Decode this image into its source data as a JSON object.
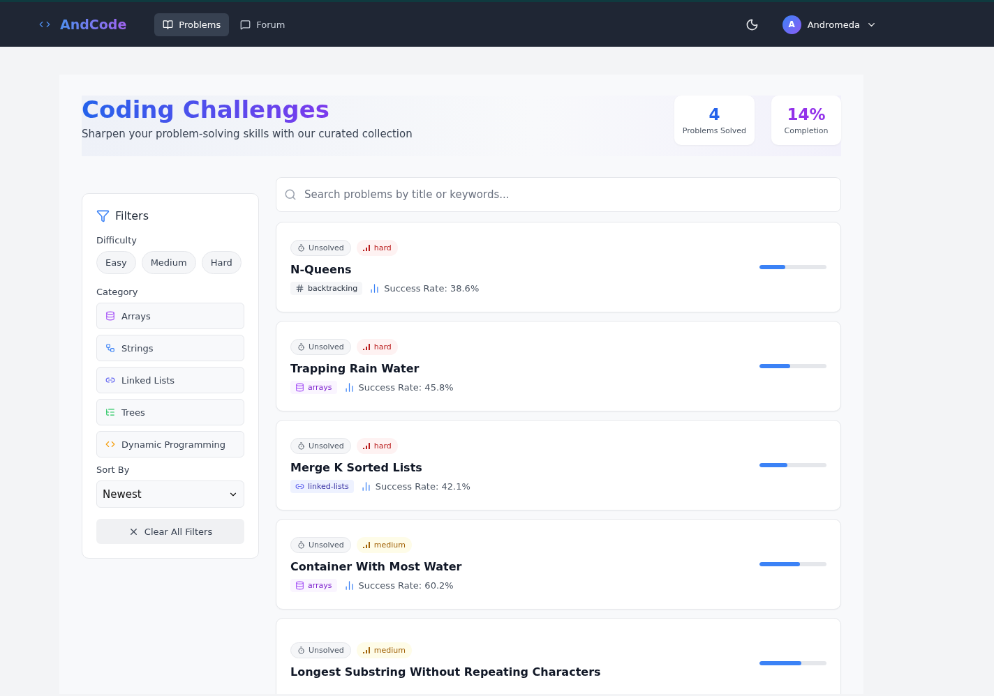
{
  "nav": {
    "logo": "AndCode",
    "links": [
      {
        "label": "Problems",
        "selected": true
      },
      {
        "label": "Forum",
        "selected": false
      }
    ],
    "user": {
      "initial": "A",
      "name": "Andromeda"
    }
  },
  "header": {
    "title": "Coding Challenges",
    "subtitle": "Sharpen your problem-solving skills with our curated collection",
    "stats": [
      {
        "value": "4",
        "label": "Problems Solved",
        "kind": "solved"
      },
      {
        "value": "14%",
        "label": "Completion",
        "kind": "completion"
      }
    ]
  },
  "filters": {
    "title": "Filters",
    "difficulty_label": "Difficulty",
    "difficulties": [
      {
        "label": "Easy",
        "selected": false
      },
      {
        "label": "Medium",
        "selected": false
      },
      {
        "label": "Hard",
        "selected": false
      }
    ],
    "category_label": "Category",
    "categories": [
      {
        "label": "Arrays",
        "kind": "arrays",
        "selected": false
      },
      {
        "label": "Strings",
        "kind": "strings",
        "selected": false
      },
      {
        "label": "Linked Lists",
        "kind": "linked",
        "selected": false
      },
      {
        "label": "Trees",
        "kind": "trees",
        "selected": false
      },
      {
        "label": "Dynamic Programming",
        "kind": "dp",
        "selected": false
      }
    ],
    "sort_label": "Sort By",
    "sort_value": "Newest",
    "clear": "Clear All Filters"
  },
  "search": {
    "placeholder": "Search problems by title or keywords..."
  },
  "problems": [
    {
      "status": "Unsolved",
      "difficulty": "hard",
      "title": "N-Queens",
      "tag": "backtracking",
      "kind": "hash",
      "rate": "Success Rate: 38.6%",
      "level": 0.386
    },
    {
      "status": "Unsolved",
      "difficulty": "hard",
      "title": "Trapping Rain Water",
      "tag": "arrays",
      "kind": "arrays",
      "rate": "Success Rate: 45.8%",
      "level": 0.458
    },
    {
      "status": "Unsolved",
      "difficulty": "hard",
      "title": "Merge K Sorted Lists",
      "tag": "linked-lists",
      "kind": "linked",
      "rate": "Success Rate: 42.1%",
      "level": 0.421
    },
    {
      "status": "Unsolved",
      "difficulty": "medium",
      "title": "Container With Most Water",
      "tag": "arrays",
      "kind": "arrays",
      "rate": "Success Rate: 60.2%",
      "level": 0.602
    },
    {
      "status": "Unsolved",
      "difficulty": "medium",
      "title": "Longest Substring Without Repeating Characters",
      "level": 0.62
    }
  ]
}
